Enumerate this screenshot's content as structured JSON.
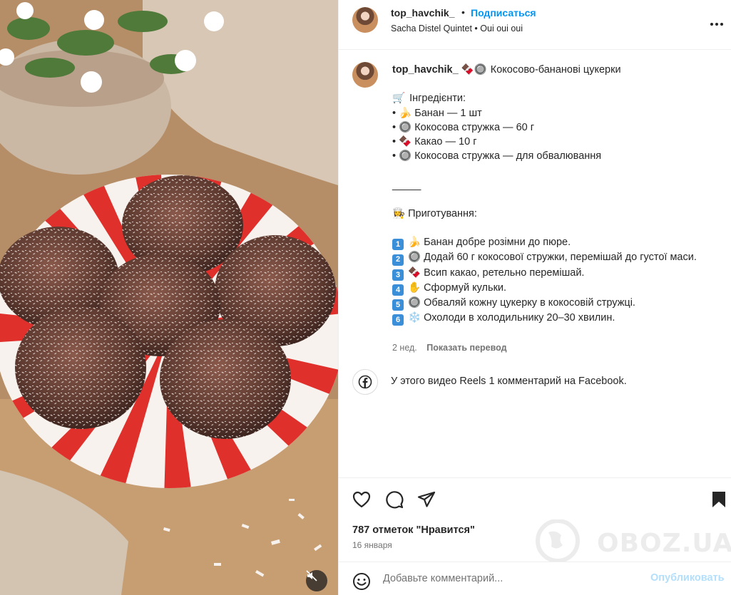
{
  "header": {
    "username": "top_havchik_",
    "separator": "•",
    "follow_label": "Подписаться",
    "subtitle": "Sacha Distel Quintet • Oui oui oui"
  },
  "caption": {
    "username": "top_havchik_",
    "lines": [
      {
        "emoji": "🍫🔘",
        "text": "Кокосово-бананові цукерки",
        "is_first": true
      },
      {
        "text": ""
      },
      {
        "emoji": "🛒",
        "text": "Інгредієнти:"
      },
      {
        "text": "• 🍌 Банан — 1 шт"
      },
      {
        "text": "• 🔘 Кокосова стружка — 60 г"
      },
      {
        "text": "• 🍫 Какао — 10 г"
      },
      {
        "text": "• 🔘 Кокосова стружка — для обвалювання"
      },
      {
        "text": ""
      },
      {
        "text": "_____"
      },
      {
        "text": ""
      },
      {
        "text": "👩‍🍳 Приготування:"
      },
      {
        "text": ""
      }
    ],
    "steps": [
      {
        "n": "1",
        "text": "🍌 Банан добре розімни до пюре."
      },
      {
        "n": "2",
        "text": "🔘 Додай 60 г кокосової стружки, перемішай до густої маси."
      },
      {
        "n": "3",
        "text": "🍫 Всип какао, ретельно перемішай."
      },
      {
        "n": "4",
        "text": "✋ Сформуй кульки."
      },
      {
        "n": "5",
        "text": "🔘 Обваляй кожну цукерку в кокосовій стружці."
      },
      {
        "n": "6",
        "text": "❄️ Охолоди в холодильнику 20–30 хвилин."
      }
    ],
    "age": "2 нед.",
    "translate_label": "Показать перевод"
  },
  "facebook_note": "У этого видео Reels 1 комментарий на Facebook.",
  "actions": {
    "likes_text": "787 отметок \"Нравится\"",
    "date": "16 января"
  },
  "comment": {
    "placeholder": "Добавьте комментарий...",
    "publish_label": "Опубликовать"
  },
  "watermark": "OBOZ.UA",
  "icons": {
    "more": "more-horizontal-icon",
    "like": "heart-icon",
    "comment": "comment-bubble-icon",
    "share": "paper-plane-icon",
    "save": "bookmark-icon",
    "emoji": "smile-icon",
    "facebook": "facebook-icon",
    "mute": "speaker-muted-icon"
  },
  "colors": {
    "link_blue": "#0095f6",
    "publish_disabled": "#b2dffc",
    "muted_text": "#737373"
  }
}
